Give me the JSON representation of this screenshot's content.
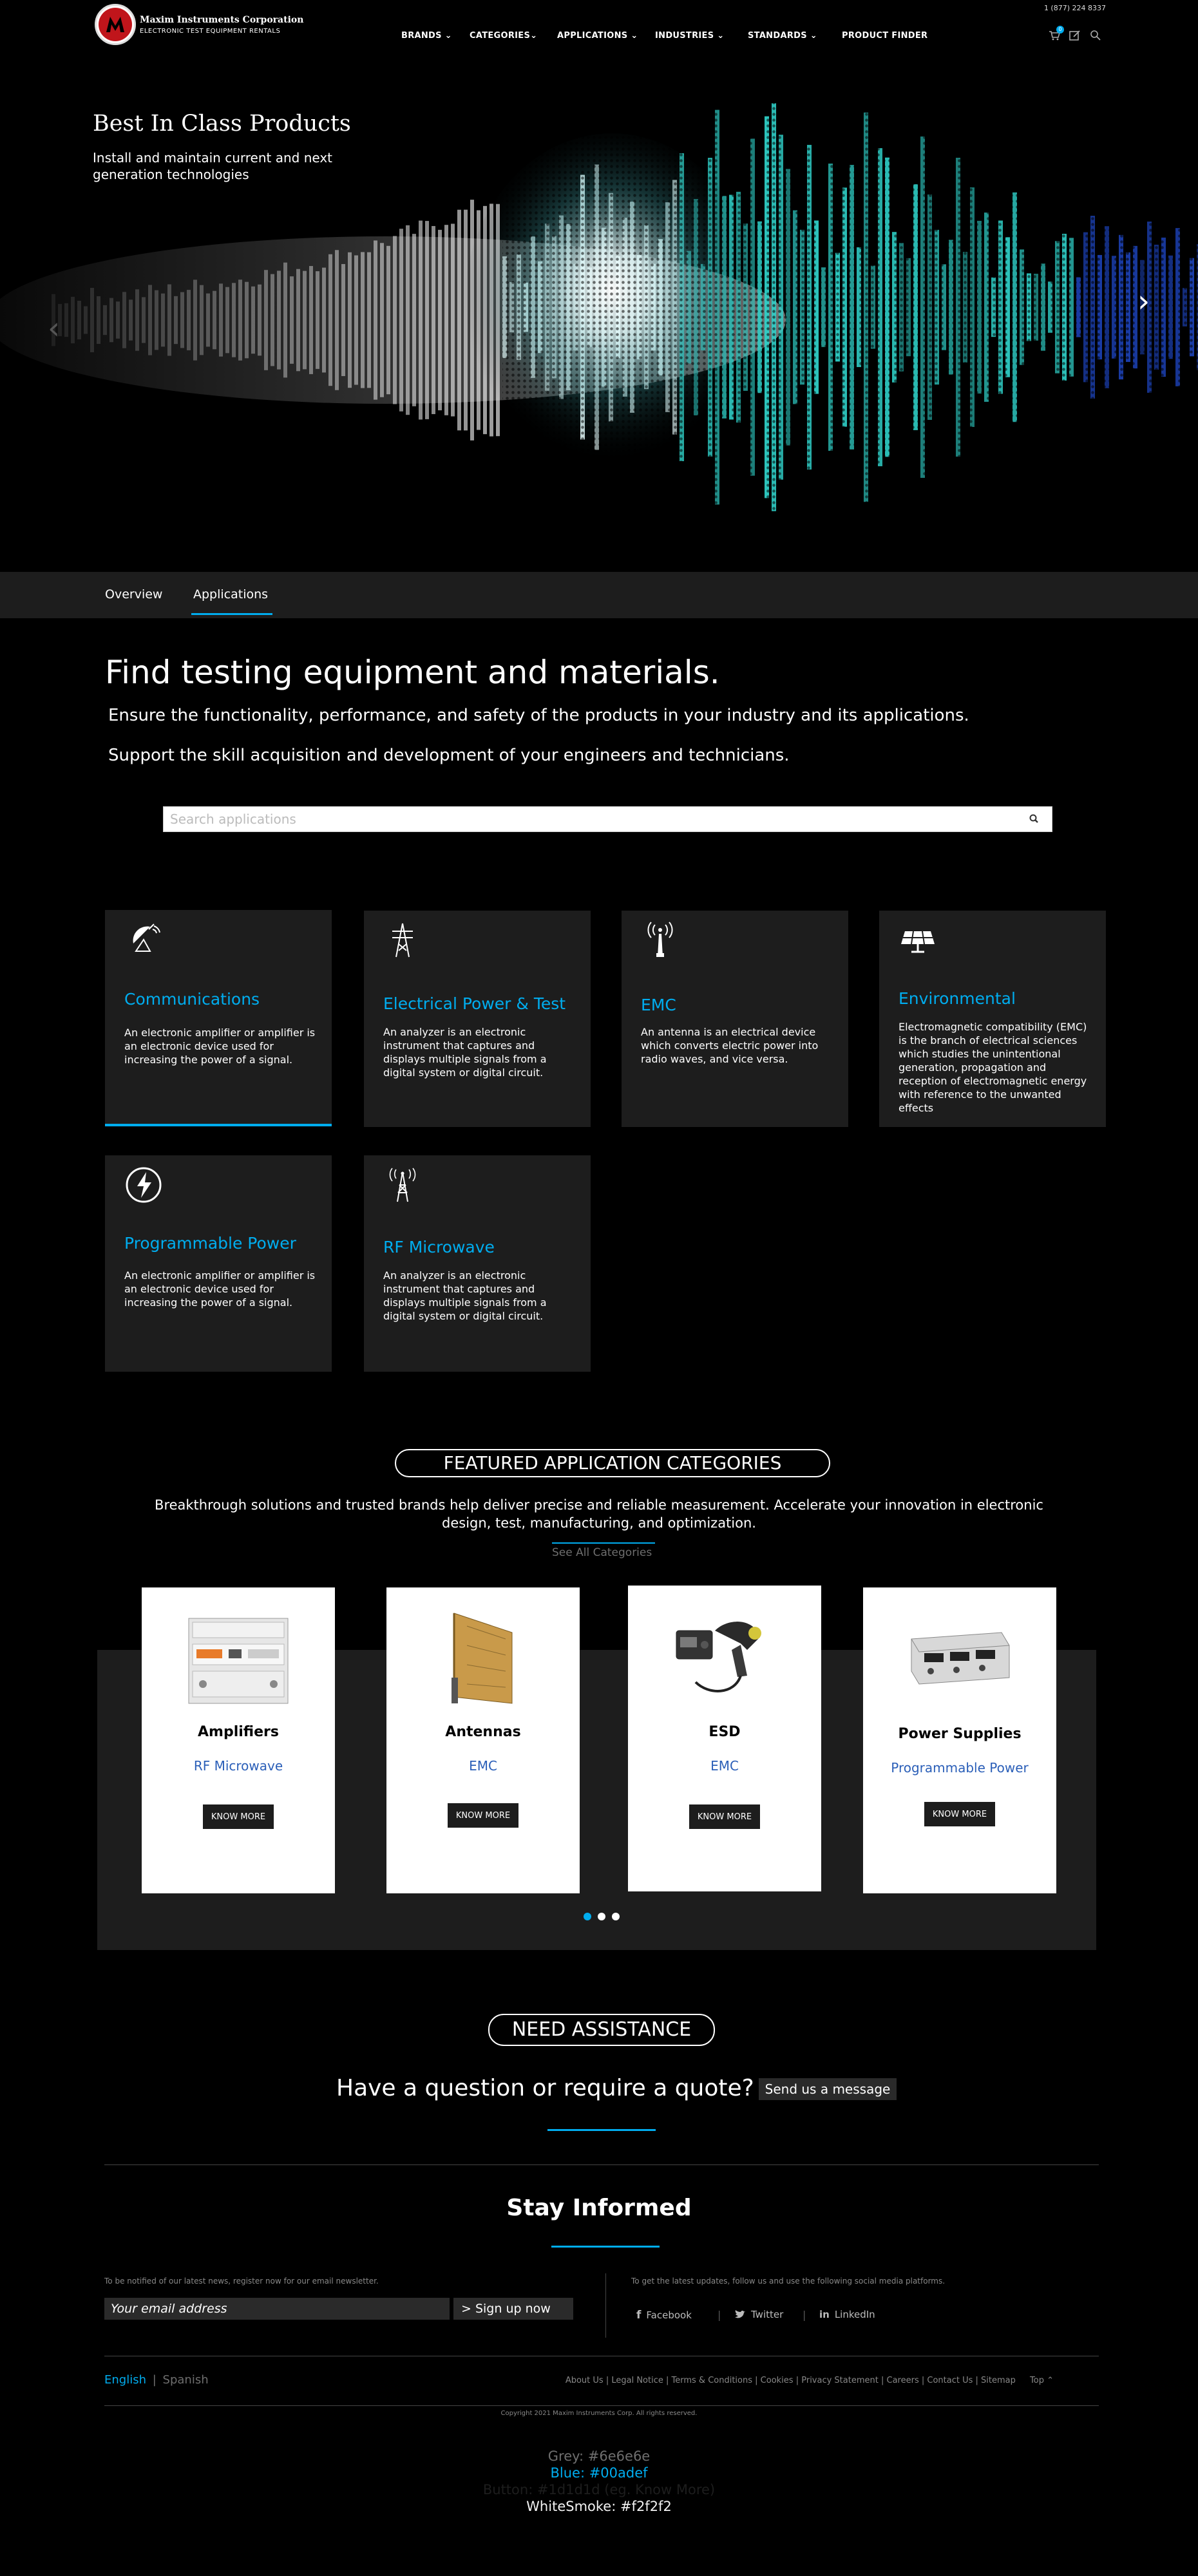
{
  "header": {
    "phone": "1 (877) 224 8337",
    "logo_name": "Maxim Instruments Corporation",
    "logo_tagline": "ELECTRONIC TEST EQUIPMENT RENTALS",
    "nav": [
      "BRANDS",
      "CATEGORIES",
      "APPLICATIONS",
      "INDUSTRIES",
      "STANDARDS",
      "PRODUCT FINDER"
    ],
    "active_nav": "APPLICATIONS",
    "cart_count": "0",
    "icons": [
      "cart-icon",
      "quote-icon",
      "search-icon"
    ]
  },
  "hero": {
    "title": "Best In Class Products",
    "subtitle": "Install and maintain current and next generation technologies"
  },
  "tabs": [
    "Overview",
    "Applications"
  ],
  "intro": {
    "title": "Find testing equipment and materials.",
    "line1": "Ensure the functionality, performance, and safety of the products in your industry and its applications.",
    "line2": "Support the skill acquisition and development of your engineers and technicians.",
    "search_placeholder": "Search applications"
  },
  "applications": [
    {
      "title": "Communications",
      "text": "An electronic amplifier or amplifier is an electronic device used for increasing the power of a signal.",
      "icon": "satellite-dish-icon"
    },
    {
      "title": "Electrical Power & Test",
      "text": "An analyzer is an electronic instrument that captures and displays multiple signals from a digital system or digital circuit.",
      "icon": "power-tower-icon"
    },
    {
      "title": "EMC",
      "text": "An antenna is an electrical device which converts electric power into radio waves, and vice versa.",
      "icon": "antenna-tower-icon"
    },
    {
      "title": "Environmental",
      "text": "Electromagnetic compatibility (EMC) is the branch of electrical sciences which studies the unintentional generation, propagation and reception of electromagnetic energy with reference to the unwanted effects",
      "icon": "solar-panel-icon"
    },
    {
      "title": "Programmable Power",
      "text": "An electronic amplifier or amplifier is an electronic device used for increasing the power of a signal.",
      "icon": "lightning-icon"
    },
    {
      "title": "RF Microwave",
      "text": "An analyzer is an electronic instrument that captures and displays multiple signals from a digital system or digital circuit.",
      "icon": "rf-tower-icon"
    }
  ],
  "featured": {
    "heading": "FEATURED APPLICATION CATEGORIES",
    "description": "Breakthrough solutions and trusted brands help deliver precise and reliable measurement. Accelerate your innovation in electronic design, test, manufacturing, and optimization.",
    "see_all": "See All Categories",
    "products": [
      {
        "name": "Amplifiers",
        "category": "RF Microwave",
        "button": "KNOW MORE"
      },
      {
        "name": "Antennas",
        "category": "EMC",
        "button": "KNOW MORE"
      },
      {
        "name": "ESD",
        "category": "EMC",
        "button": "KNOW MORE"
      },
      {
        "name": "Power Supplies",
        "category": "Programmable Power",
        "button": "KNOW MORE"
      }
    ]
  },
  "assistance": {
    "heading": "NEED ASSISTANCE",
    "question": "Have a question or require a quote?",
    "button": "Send us a message"
  },
  "newsletter": {
    "title": "Stay Informed",
    "note_left": "To be notified of our latest news, register now for our email newsletter.",
    "email_placeholder": "Your email address",
    "signup": "> Sign up now",
    "note_right": "To get the latest updates, follow us and use the following social media platforms.",
    "social": [
      "Facebook",
      "Twitter",
      "LinkedIn"
    ]
  },
  "footer": {
    "languages": [
      "English",
      "Spanish"
    ],
    "links": [
      "About Us",
      "Legal Notice",
      "Terms & Conditions",
      "Cookies",
      "Privacy Statement",
      "Careers",
      "Contact Us",
      "Sitemap",
      "Top"
    ],
    "copyright": "Copyright 2021 Maxim Instruments Corp. All rights reserved."
  },
  "swatches": [
    {
      "label": "Grey: #6e6e6e",
      "color": "#6e6e6e"
    },
    {
      "label": "Blue: #00adef",
      "color": "#00adef"
    },
    {
      "label": "Button: #1d1d1d (eg. Know More)",
      "color": "#1d1d1d"
    },
    {
      "label": "WhiteSmoke: #f2f2f2",
      "color": "#f2f2f2"
    }
  ]
}
